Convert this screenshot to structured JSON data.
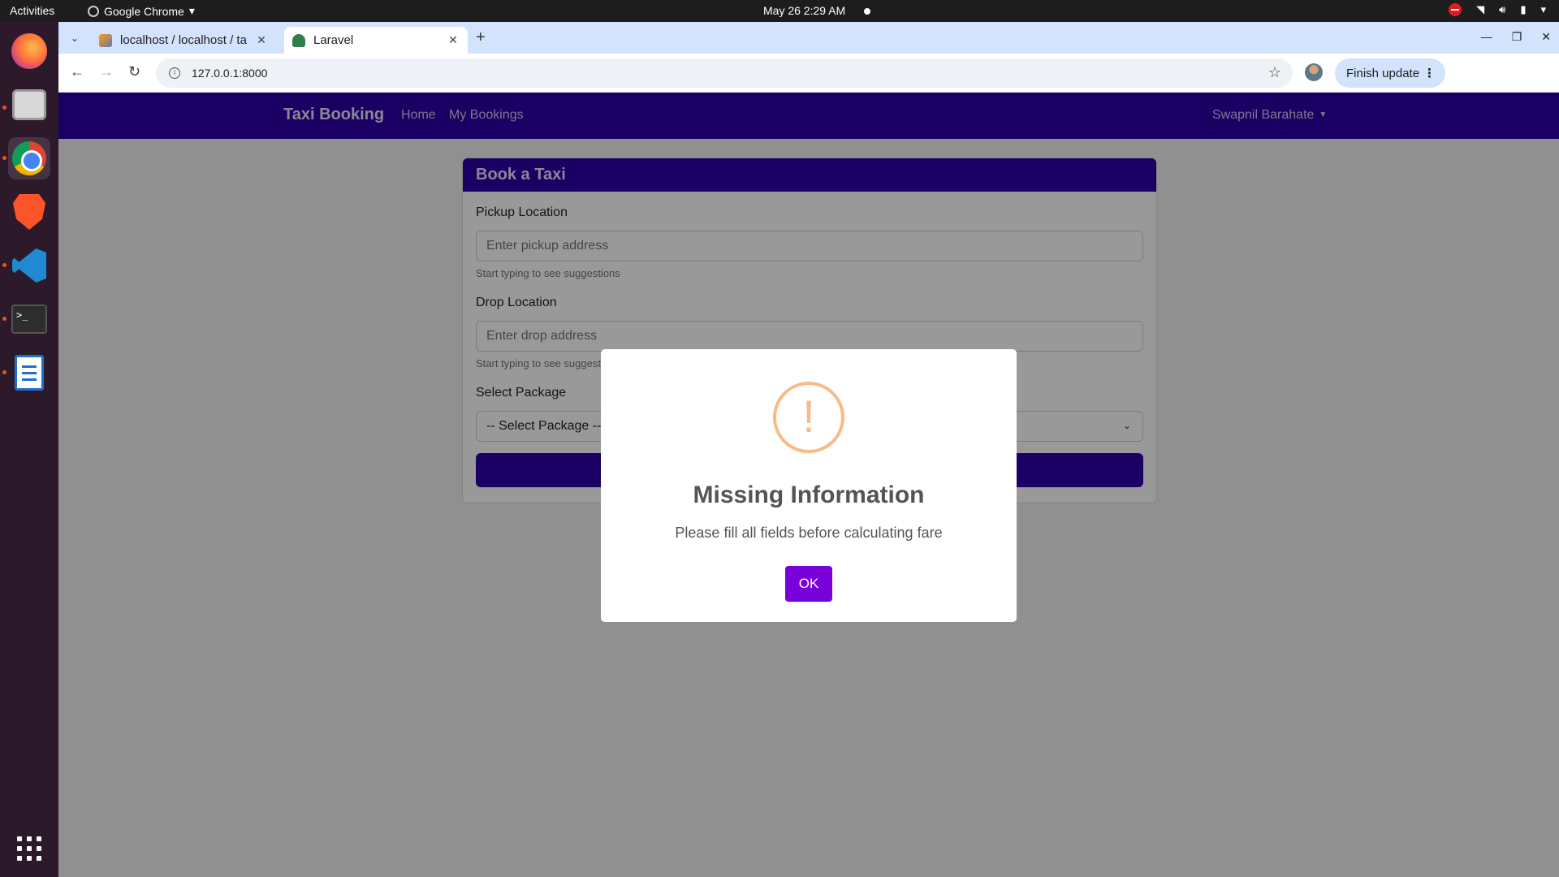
{
  "system": {
    "activities": "Activities",
    "app_menu": "Google Chrome",
    "clock": "May 26  2:29 AM"
  },
  "dock": {
    "apps": [
      "Firefox",
      "Files",
      "Google Chrome",
      "Brave",
      "Visual Studio Code",
      "Terminal",
      "LibreOffice Writer"
    ],
    "terminal_prompt": ">_"
  },
  "browser": {
    "tabs": [
      {
        "label": "localhost / localhost / ta"
      },
      {
        "label": "Laravel"
      }
    ],
    "url": "127.0.0.1:8000",
    "finish_update": "Finish update"
  },
  "navbar": {
    "brand": "Taxi Booking",
    "links": [
      "Home",
      "My Bookings"
    ],
    "user": "Swapnil Barahate"
  },
  "form": {
    "title": "Book a Taxi",
    "pickup_label": "Pickup Location",
    "pickup_placeholder": "Enter pickup address",
    "pickup_help": "Start typing to see suggestions",
    "drop_label": "Drop Location",
    "drop_placeholder": "Enter drop address",
    "drop_help": "Start typing to see suggestions",
    "package_label": "Select Package",
    "package_selected": "-- Select Package --"
  },
  "modal": {
    "icon": "!",
    "title": "Missing Information",
    "text": "Please fill all fields before calculating fare",
    "ok": "OK"
  },
  "colors": {
    "navbar": "#2c00a3",
    "ok_button": "#7a00d9",
    "warning": "#f8bb86"
  }
}
